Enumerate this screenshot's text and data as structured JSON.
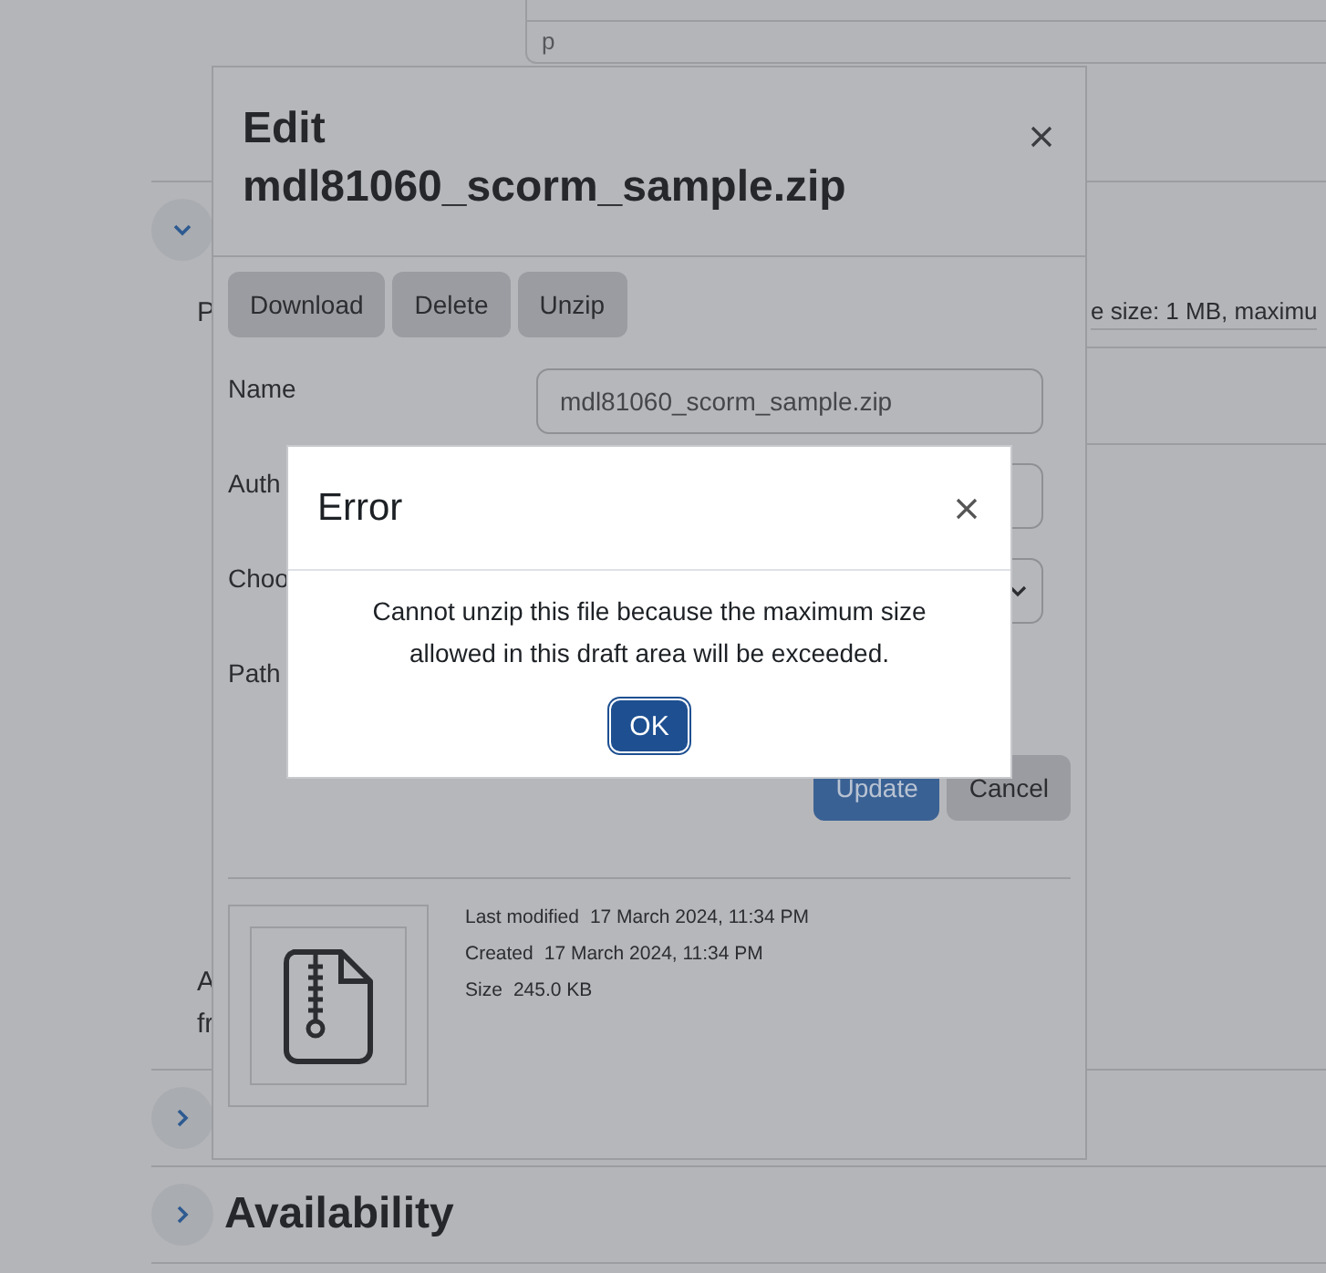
{
  "background": {
    "editor_footer": "p",
    "section_1": {
      "expanded": true,
      "text_fragment": "P",
      "file_limits": "e size: 1 MB, maximu",
      "text_lines": [
        "A",
        "fr"
      ]
    },
    "section_2": {
      "expanded": false
    },
    "section_3": {
      "title": "Availability",
      "expanded": false
    }
  },
  "edit_dialog": {
    "title": "Edit mdl81060_scorm_sample.zip",
    "actions": [
      "Download",
      "Delete",
      "Unzip"
    ],
    "fields": [
      {
        "label": "Name",
        "kind": "text",
        "value": "mdl81060_scorm_sample.zip"
      },
      {
        "label": "Auth",
        "kind": "text"
      },
      {
        "label": "Choo",
        "kind": "select"
      },
      {
        "label": "Path",
        "kind": "none"
      }
    ],
    "buttons": [
      {
        "label": "Update",
        "kind": "primary"
      },
      {
        "label": "Cancel",
        "kind": "secondary"
      }
    ],
    "file_info": [
      {
        "label": "Last modified",
        "value": "17 March 2024, 11:34 PM"
      },
      {
        "label": "Created",
        "value": "17 March 2024, 11:34 PM"
      },
      {
        "label": "Size",
        "value": "245.0 KB"
      }
    ]
  },
  "error_dialog": {
    "title": "Error",
    "message": "Cannot unzip this file because the maximum size allowed in this draft area will be exceeded.",
    "button": {
      "label": "OK",
      "focused": true
    }
  }
}
